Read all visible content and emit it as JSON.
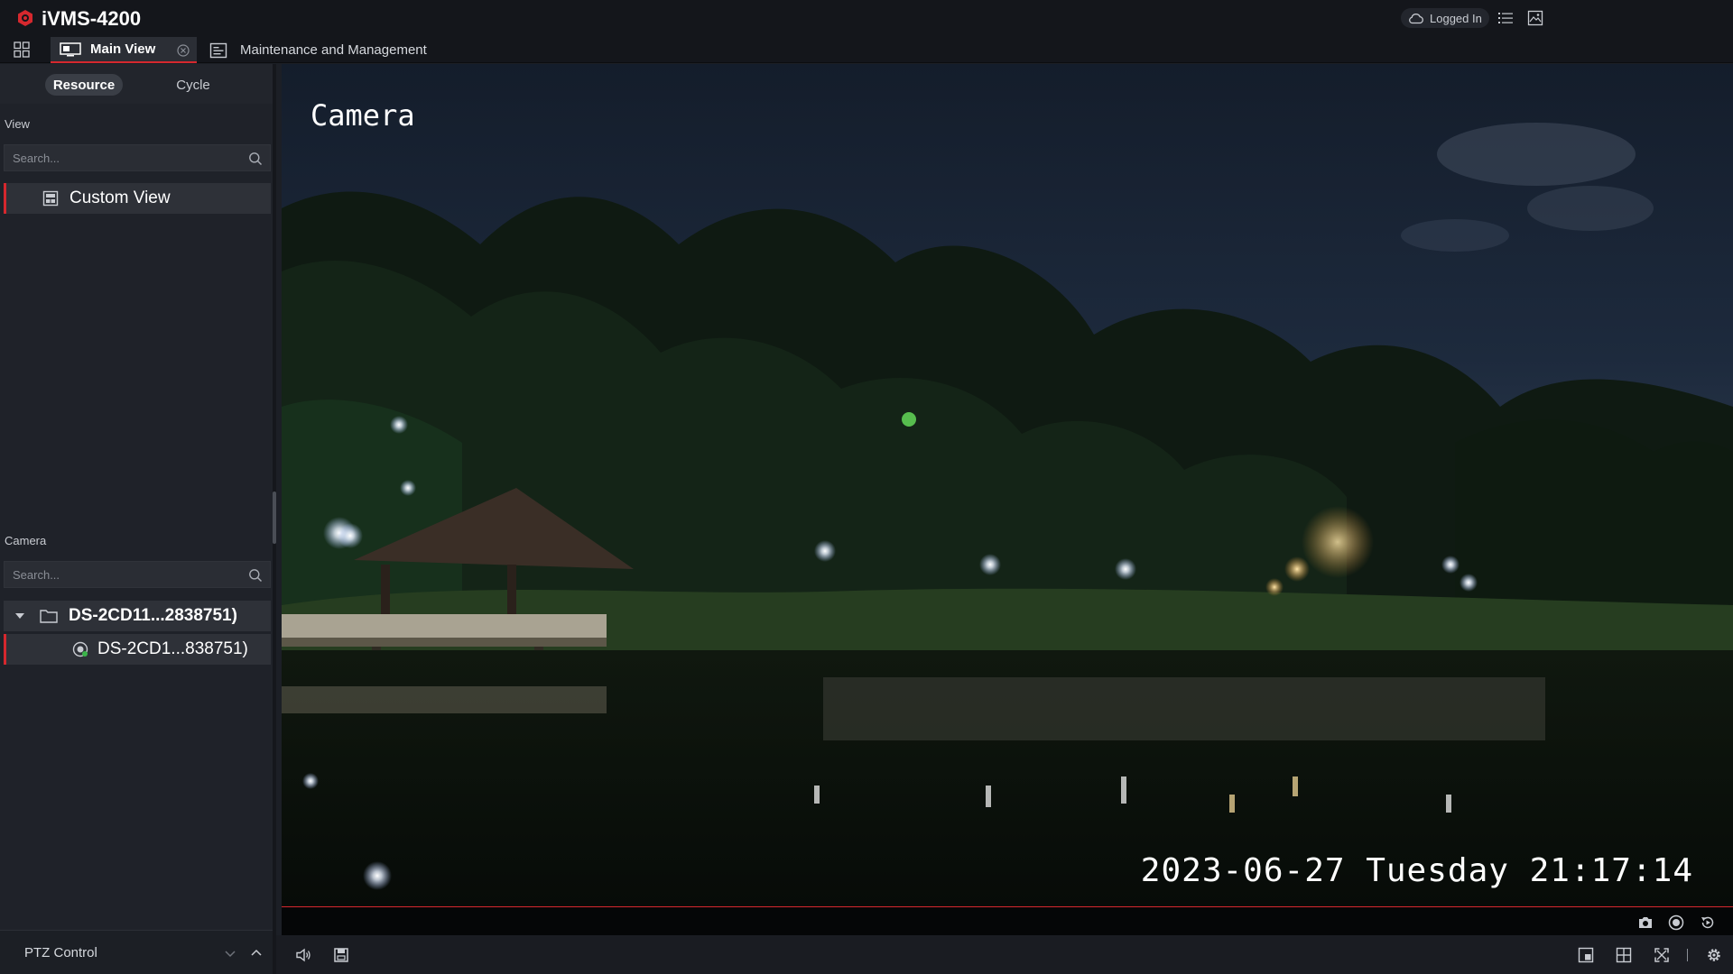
{
  "app": {
    "title": "iVMS-4200",
    "login_status": "Logged In"
  },
  "tabs": [
    {
      "label": "Main View",
      "active": true
    },
    {
      "label": "Maintenance and Management",
      "active": false
    }
  ],
  "sidebar": {
    "segments": [
      {
        "label": "Resource",
        "active": true
      },
      {
        "label": "Cycle",
        "active": false
      }
    ],
    "view_section": {
      "label": "View",
      "search_placeholder": "Search...",
      "items": [
        {
          "label": "Custom View",
          "selected": true
        }
      ]
    },
    "camera_section": {
      "label": "Camera",
      "search_placeholder": "Search...",
      "tree": {
        "device": {
          "label": "DS-2CD11...2838751)",
          "expanded": true
        },
        "channels": [
          {
            "label": "DS-2CD1...838751)",
            "selected": true
          }
        ]
      }
    },
    "ptz": {
      "label": "PTZ Control"
    }
  },
  "video": {
    "osd_title": "Camera",
    "osd_timestamp": "2023-06-27 Tuesday 21:17:14"
  },
  "colors": {
    "accent": "#d6282e",
    "background": "#1c1f26",
    "panel": "#1f2229"
  },
  "icons": {
    "title_bar": [
      "logo-icon",
      "cloud-icon",
      "task-list-icon",
      "picture-icon"
    ],
    "video_toolbar": [
      "capture-icon",
      "record-icon",
      "instant-playback-icon"
    ],
    "bottom_bar": [
      "volume-icon",
      "save-view-icon",
      "window-single-icon",
      "window-layout-icon",
      "fullscreen-icon",
      "settings-icon"
    ]
  }
}
